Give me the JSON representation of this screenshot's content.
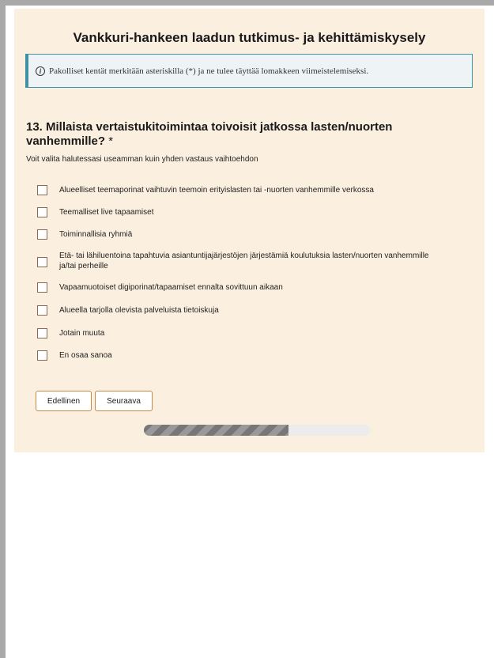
{
  "form": {
    "title": "Vankkuri-hankeen laadun tutkimus- ja kehittämiskysely",
    "notice": "Pakolliset kentät merkitään asteriskilla (*) ja ne tulee täyttää lomakkeen viimeistelemiseksi.",
    "notice_icon": "info-icon"
  },
  "question": {
    "text": "13. Millaista vertaistukitoimintaa toivoisit jatkossa lasten/nuorten vanhemmille?",
    "required_marker": "*",
    "hint": "Voit valita halutessasi useamman kuin yhden vastaus vaihtoehdon",
    "options": [
      {
        "label": "Alueelliset teemaporinat vaihtuvin teemoin erityislasten tai -nuorten vanhemmille verkossa",
        "checked": false
      },
      {
        "label": "Teemalliset live tapaamiset",
        "checked": false
      },
      {
        "label": "Toiminnallisia ryhmiä",
        "checked": false
      },
      {
        "label": "Etä- tai lähiluentoina tapahtuvia asiantuntijajärjestöjen järjestämiä koulutuksia lasten/nuorten vanhemmille ja/tai perheille",
        "checked": false
      },
      {
        "label": "Vapaamuotoiset digiporinat/tapaamiset ennalta sovittuun aikaan",
        "checked": false
      },
      {
        "label": "Alueella tarjolla olevista palveluista tietoiskuja",
        "checked": false
      },
      {
        "label": "Jotain muuta",
        "checked": false
      },
      {
        "label": "En osaa sanoa",
        "checked": false
      }
    ]
  },
  "nav": {
    "prev_label": "Edellinen",
    "next_label": "Seuraava"
  },
  "progress": {
    "fraction": 0.64
  },
  "colors": {
    "card_background": "#fbefdf",
    "notice_border": "#3f8fa6",
    "button_border": "#c4884a"
  }
}
